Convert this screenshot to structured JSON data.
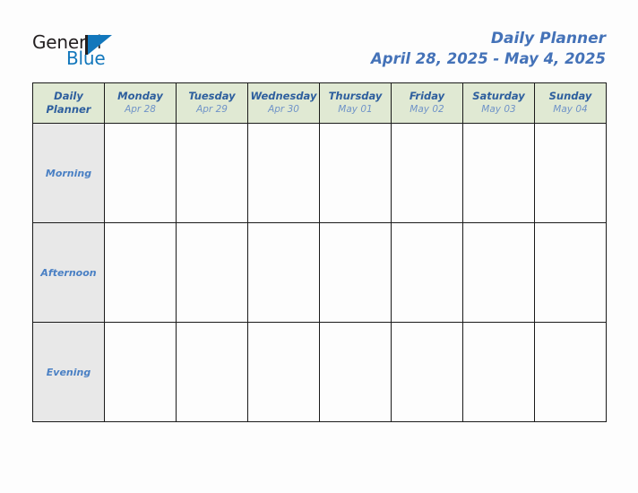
{
  "brand": {
    "logo_text_primary": "General",
    "logo_text_secondary": "Blue",
    "logo_mark": "triangle-mark",
    "primary_color": "#1277bc",
    "dark_color": "#231f20"
  },
  "header": {
    "title": "Daily Planner",
    "date_range": "April 28, 2025 - May 4, 2025",
    "title_color": "#4472b8"
  },
  "table": {
    "corner_label_line1": "Daily",
    "corner_label_line2": "Planner",
    "header_bg": "#e0e9d3",
    "row_label_bg": "#e8e8e8",
    "cell_bg": "#fdfdfd",
    "border_color": "#1a1a1a",
    "columns": [
      {
        "day": "Monday",
        "date": "Apr 28"
      },
      {
        "day": "Tuesday",
        "date": "Apr 29"
      },
      {
        "day": "Wednesday",
        "date": "Apr 30"
      },
      {
        "day": "Thursday",
        "date": "May 01"
      },
      {
        "day": "Friday",
        "date": "May 02"
      },
      {
        "day": "Saturday",
        "date": "May 03"
      },
      {
        "day": "Sunday",
        "date": "May 04"
      }
    ],
    "rows": [
      {
        "label": "Morning",
        "cells": [
          "",
          "",
          "",
          "",
          "",
          "",
          ""
        ]
      },
      {
        "label": "Afternoon",
        "cells": [
          "",
          "",
          "",
          "",
          "",
          "",
          ""
        ]
      },
      {
        "label": "Evening",
        "cells": [
          "",
          "",
          "",
          "",
          "",
          "",
          ""
        ]
      }
    ]
  }
}
